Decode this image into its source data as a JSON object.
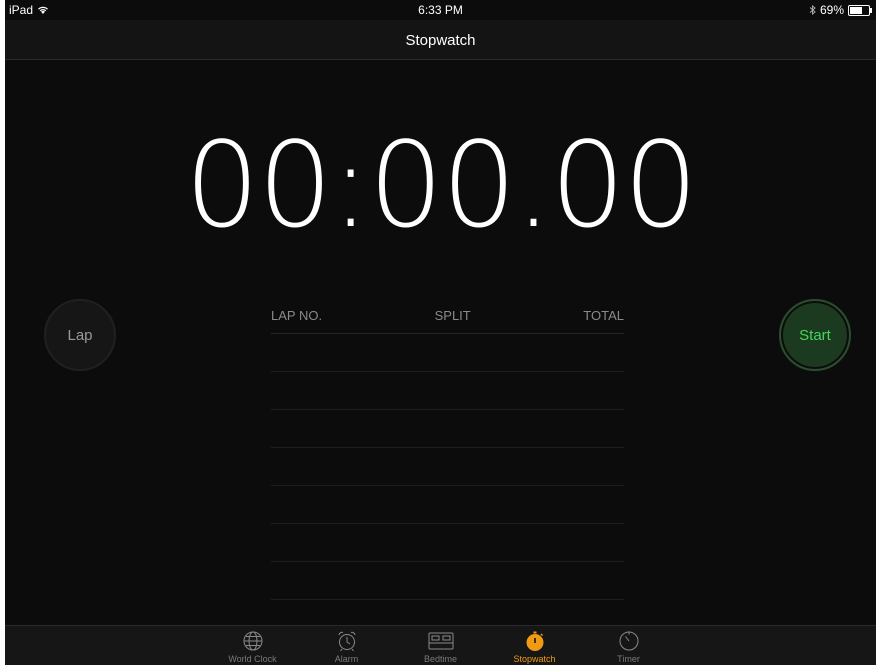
{
  "status_bar": {
    "device": "iPad",
    "time": "6:33 PM",
    "battery": "69%",
    "battery_level": 0.69
  },
  "nav": {
    "title": "Stopwatch"
  },
  "stopwatch": {
    "time": "00:00.00"
  },
  "buttons": {
    "lap": "Lap",
    "start": "Start"
  },
  "lap_table": {
    "headers": [
      "LAP NO.",
      "SPLIT",
      "TOTAL"
    ],
    "rows": []
  },
  "tabs": [
    {
      "label": "World Clock",
      "icon": "globe-icon",
      "active": false
    },
    {
      "label": "Alarm",
      "icon": "alarm-icon",
      "active": false
    },
    {
      "label": "Bedtime",
      "icon": "bed-icon",
      "active": false
    },
    {
      "label": "Stopwatch",
      "icon": "stopwatch-icon",
      "active": true
    },
    {
      "label": "Timer",
      "icon": "timer-icon",
      "active": false
    }
  ],
  "colors": {
    "accent": "#f19a13",
    "start_green": "#44d65b",
    "background": "#0c0c0c"
  }
}
